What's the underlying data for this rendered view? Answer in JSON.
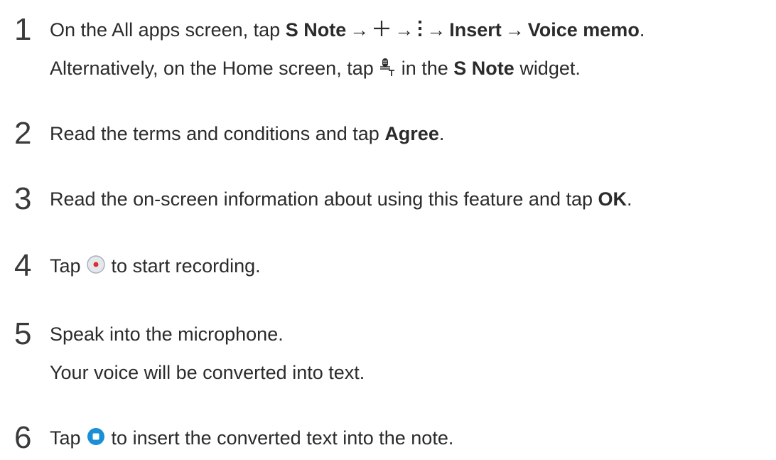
{
  "steps": [
    {
      "number": "1",
      "line1": {
        "t1": "On the All apps screen, tap ",
        "app": "S Note",
        "arrow": "→",
        "insert": "Insert",
        "voice_memo": "Voice memo",
        "end": "."
      },
      "line2": {
        "t1": "Alternatively, on the Home screen, tap ",
        "t2": " in the ",
        "widget_name": "S Note",
        "t3": " widget."
      }
    },
    {
      "number": "2",
      "t1": "Read the terms and conditions and tap ",
      "bold": "Agree",
      "end": "."
    },
    {
      "number": "3",
      "t1": "Read the on-screen information about using this feature and tap ",
      "bold": "OK",
      "end": "."
    },
    {
      "number": "4",
      "t1": "Tap ",
      "t2": " to start recording."
    },
    {
      "number": "5",
      "line1": "Speak into the microphone.",
      "line2": "Your voice will be converted into text."
    },
    {
      "number": "6",
      "t1": "Tap ",
      "t2": " to insert the converted text into the note."
    }
  ],
  "icons": {
    "plus": "plus-icon",
    "more": "more-options-icon",
    "voice_to_text": "voice-to-text-icon",
    "record": "record-button-icon",
    "stop": "stop-button-icon"
  },
  "colors": {
    "text": "#2b2b2b",
    "record_dot": "#d9302c",
    "stop_blue": "#1a8fd6"
  }
}
